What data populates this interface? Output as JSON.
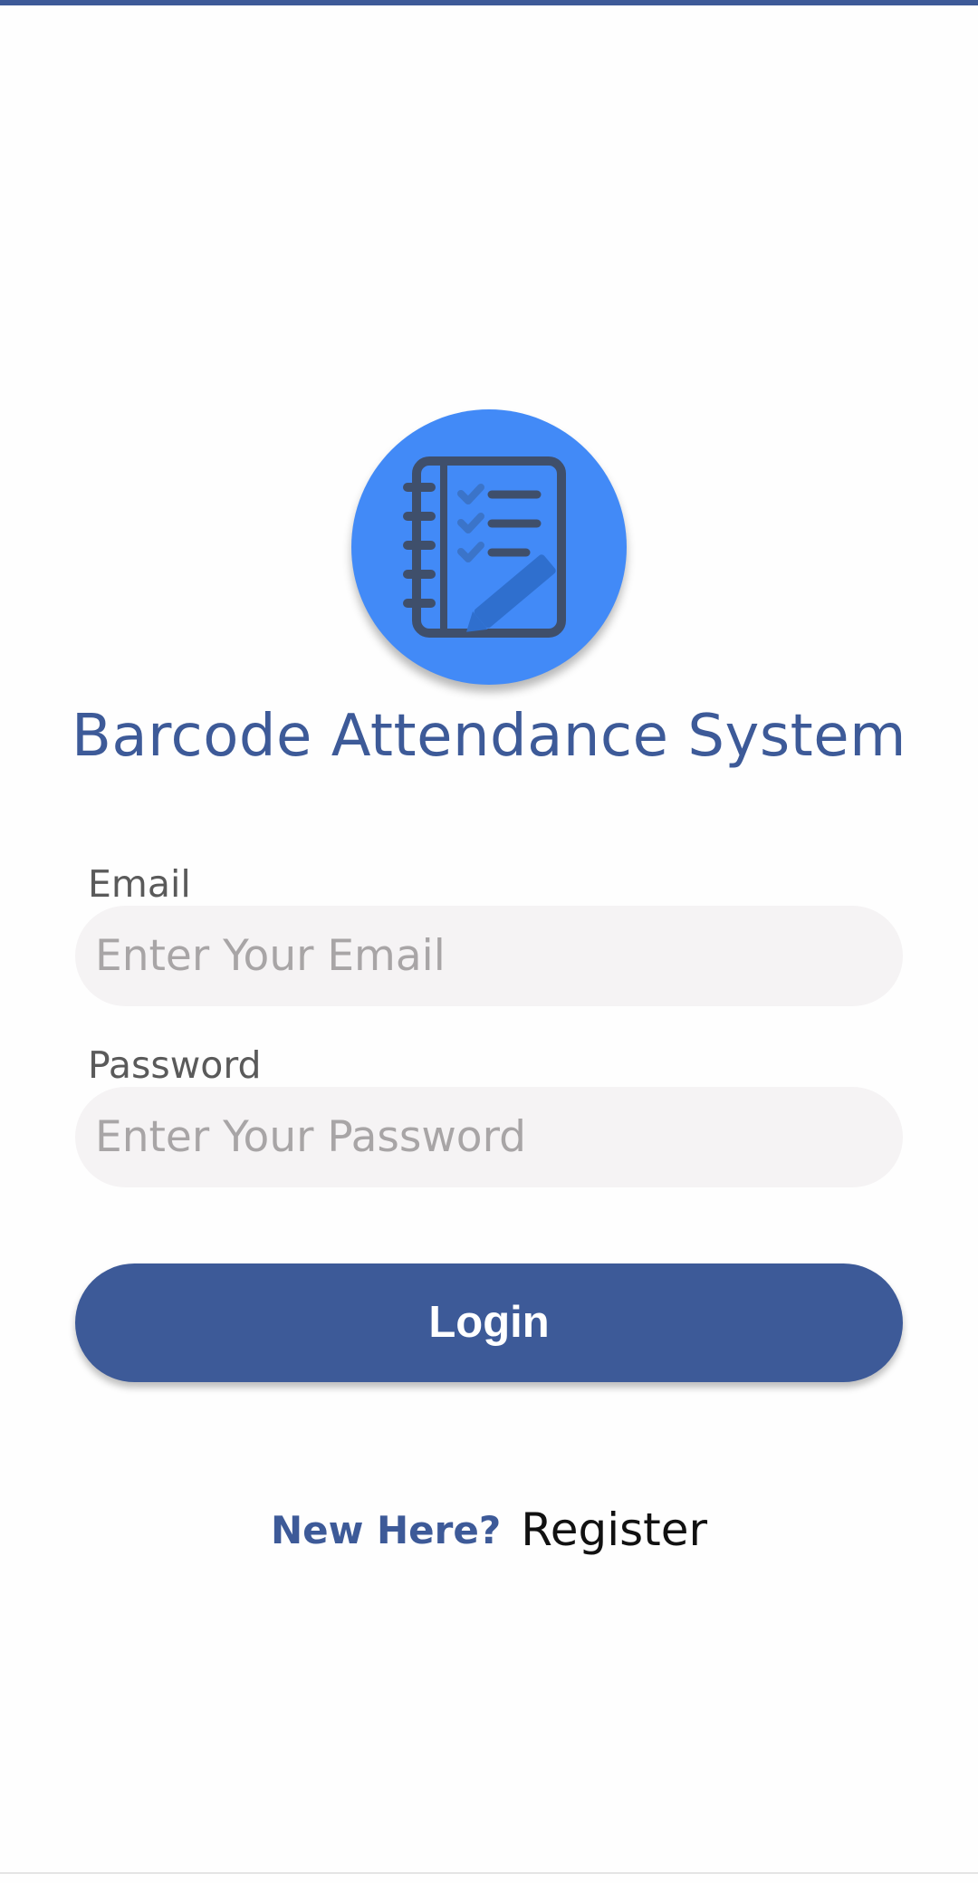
{
  "app": {
    "title": "Barcode Attendance System",
    "logo_icon": "notebook-checklist-icon"
  },
  "form": {
    "email_label": "Email",
    "email_placeholder": "Enter Your Email",
    "email_value": "",
    "password_label": "Password",
    "password_placeholder": "Enter Your Password",
    "password_value": "",
    "login_label": "Login"
  },
  "footer": {
    "prompt": "New Here?",
    "register_label": "Register"
  },
  "colors": {
    "primary": "#3d5a98",
    "logo_background": "#428af7",
    "field_background": "#f5f3f4",
    "placeholder": "#a8a5a6"
  }
}
